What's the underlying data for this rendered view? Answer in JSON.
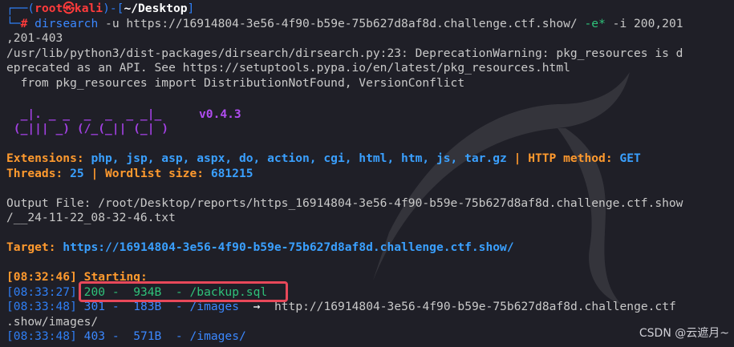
{
  "prompt": {
    "user": "root",
    "skull": "㉿",
    "host": "kali",
    "cwd": "~/Desktop",
    "prefix_top": "┌──(",
    "mid": ")-[",
    "suffix_top": "]",
    "prefix_bottom": "└─",
    "hash": "#"
  },
  "command": {
    "program": "dirsearch",
    "args_part1": " -u https://16914804-3e56-4f90-b59e-75b627d8af8d.challenge.ctf.show/",
    "flag_e": " -e*",
    "args_part2": " -i 200,201",
    "wrap": ",201-403"
  },
  "warning_lines": [
    "/usr/lib/python3/dist-packages/dirsearch/dirsearch.py:23: DeprecationWarning: pkg_resources is d",
    "eprecated as an API. See https://setuptools.pypa.io/en/latest/pkg_resources.html",
    "  from pkg_resources import DistributionNotFound, VersionConflict"
  ],
  "banner": {
    "art_line1": "  _|. _ _  _  _  _ _|_",
    "art_line2": " (_||| _) (/_(_|| (_| )",
    "version": "v0.4.3"
  },
  "config": {
    "extensions_label": "Extensions: ",
    "extensions_value": "php, jsp, asp, aspx, do, action, cgi, html, htm, js, tar.gz",
    "sep": " | ",
    "http_method_label": "HTTP method: ",
    "http_method_value": "GET",
    "threads_label": "Threads: ",
    "threads_value": "25",
    "wordlist_label": "Wordlist size: ",
    "wordlist_value": "681215"
  },
  "output_file": {
    "line1": "Output File: /root/Desktop/reports/https_16914804-3e56-4f90-b59e-75b627d8af8d.challenge.ctf.show",
    "line2": "/__24-11-22_08-32-46.txt"
  },
  "target": {
    "label": "Target: ",
    "url": "https://16914804-3e56-4f90-b59e-75b627d8af8d.challenge.ctf.show/"
  },
  "starting": {
    "timestamp": "[08:32:46]",
    "text": " Starting: "
  },
  "results": [
    {
      "timestamp": "[08:33:27]",
      "status": "200",
      "size": "934B",
      "path": "/backup.sql",
      "redirect": ""
    },
    {
      "timestamp": "[08:33:48]",
      "status": "301",
      "size": "183B",
      "path": "/images",
      "redirect": "http://16914804-3e56-4f90-b59e-75b627d8af8d.challenge.ctf",
      "redirect_wrap": ".show/images/"
    },
    {
      "timestamp": "[08:33:48]",
      "status": "403",
      "size": "571B",
      "path": "/images/",
      "redirect": ""
    }
  ],
  "arrow": "→",
  "watermark": "CSDN @云遮月~",
  "colors": {
    "background": "#1f1f27",
    "prompt_blue": "#2f7ff5",
    "root_red": "#ff3b3b",
    "orange": "#ff9a2e",
    "purple": "#a040e0",
    "green_200": "#2fc27a",
    "highlight_box": "#e8485a"
  }
}
